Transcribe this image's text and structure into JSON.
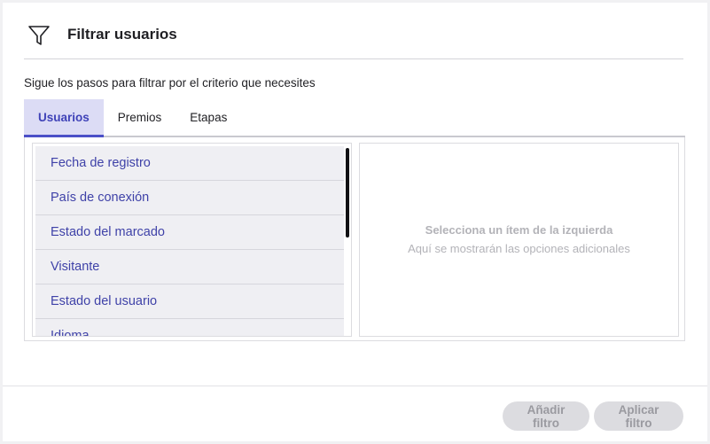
{
  "header": {
    "title": "Filtrar usuarios",
    "icon": "filter-icon"
  },
  "subtitle": "Sigue los pasos para filtrar por el criterio que necesites",
  "tabs": [
    {
      "label": "Usuarios",
      "active": true
    },
    {
      "label": "Premios",
      "active": false
    },
    {
      "label": "Etapas",
      "active": false
    }
  ],
  "list": {
    "items": [
      {
        "label": "Fecha de registro"
      },
      {
        "label": "País de conexión"
      },
      {
        "label": "Estado del marcado"
      },
      {
        "label": "Visitante"
      },
      {
        "label": "Estado del usuario"
      },
      {
        "label": "Idioma"
      }
    ]
  },
  "detail": {
    "empty_title": "Selecciona un ítem de la izquierda",
    "empty_desc": "Aquí se mostrarán las opciones adicionales"
  },
  "footer": {
    "add_filter": "Añadir filtro",
    "apply_filter": "Aplicar filtro"
  },
  "colors": {
    "accent": "#4b4fc8",
    "tab_active_bg": "#dcdcf5",
    "list_text": "#3f42a8",
    "disabled_button_bg": "#dcdce0"
  }
}
